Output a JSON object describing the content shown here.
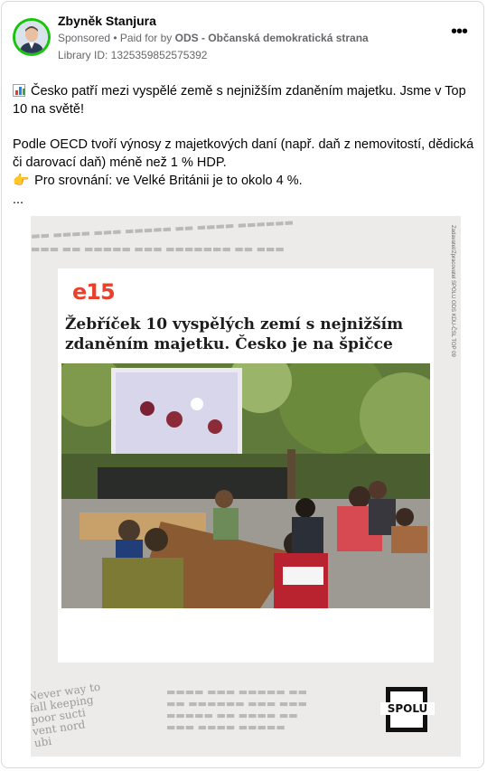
{
  "post": {
    "author": "Zbyněk Stanjura",
    "sponsored": "Sponsored",
    "paid_prefix": " • Paid for by ",
    "paid_by": "ODS - Občanská demokratická strana",
    "library_id": "Library ID: 1325359852575392",
    "more_icon": "more-options-icon",
    "text_line1": "Česko patří mezi vyspělé země s nejnižším zdaněním majetku. Jsme v Top 10 na světě!",
    "text_line2": "Podle OECD tvoří výnosy z majetkových daní (např. daň z nemovitostí, dědická či darovací daň) méně než 1 % HDP.",
    "text_line3": "Pro srovnání: ve Velké Británii je to okolo 4 %.",
    "ellipsis": "..."
  },
  "creative": {
    "logo": "e15",
    "headline": "Žebříček 10 vyspělých zemí s nejnižším zdaněním majetku. Česko je na špičce",
    "side_text": "Zadavatel/Zpracovatel SPOLU ODS KDU-ČSL TOP 09",
    "brand": "SPOLU",
    "news_bits": [
      "Never way to",
      "fall keeping",
      "poor sucti",
      "vent nord",
      "ubi"
    ],
    "accent_color": "#e8412c"
  }
}
